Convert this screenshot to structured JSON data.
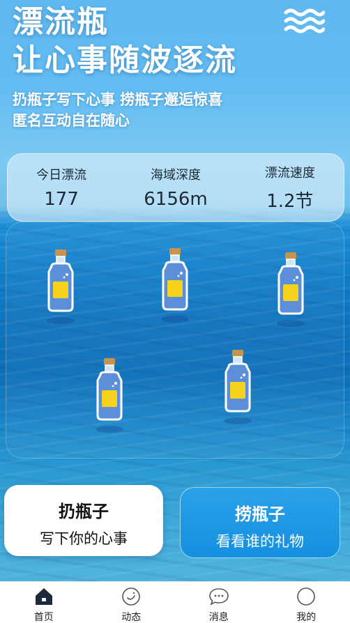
{
  "header": {
    "title_line1": "漂流瓶",
    "title_line2": "让心事随波逐流",
    "subtitle_line1": "扔瓶子写下心事 捞瓶子邂逅惊喜",
    "subtitle_line2": "匿名互动自在随心",
    "menu_icon": "waves-icon"
  },
  "stats": [
    {
      "label": "今日漂流",
      "value": "177"
    },
    {
      "label": "海域深度",
      "value": "6156m"
    },
    {
      "label": "漂流速度",
      "value": "1.2节"
    }
  ],
  "bottles": {
    "count": 5,
    "icon": "bottle-icon",
    "colors": {
      "glass": "#5b8fd9",
      "paper": "#f7d21c",
      "cork": "#c8934e"
    }
  },
  "actions": {
    "throw": {
      "title": "扔瓶子",
      "subtitle": "写下你的心事"
    },
    "pick": {
      "title": "捞瓶子",
      "subtitle": "看看谁的礼物"
    }
  },
  "tabs": [
    {
      "label": "首页",
      "icon": "home-icon",
      "active": true
    },
    {
      "label": "动态",
      "icon": "smile-icon",
      "active": false
    },
    {
      "label": "消息",
      "icon": "message-icon",
      "active": false
    },
    {
      "label": "我的",
      "icon": "profile-icon",
      "active": false
    }
  ],
  "colors": {
    "accent": "#1590df",
    "tab_active": "#1c2a3a"
  }
}
